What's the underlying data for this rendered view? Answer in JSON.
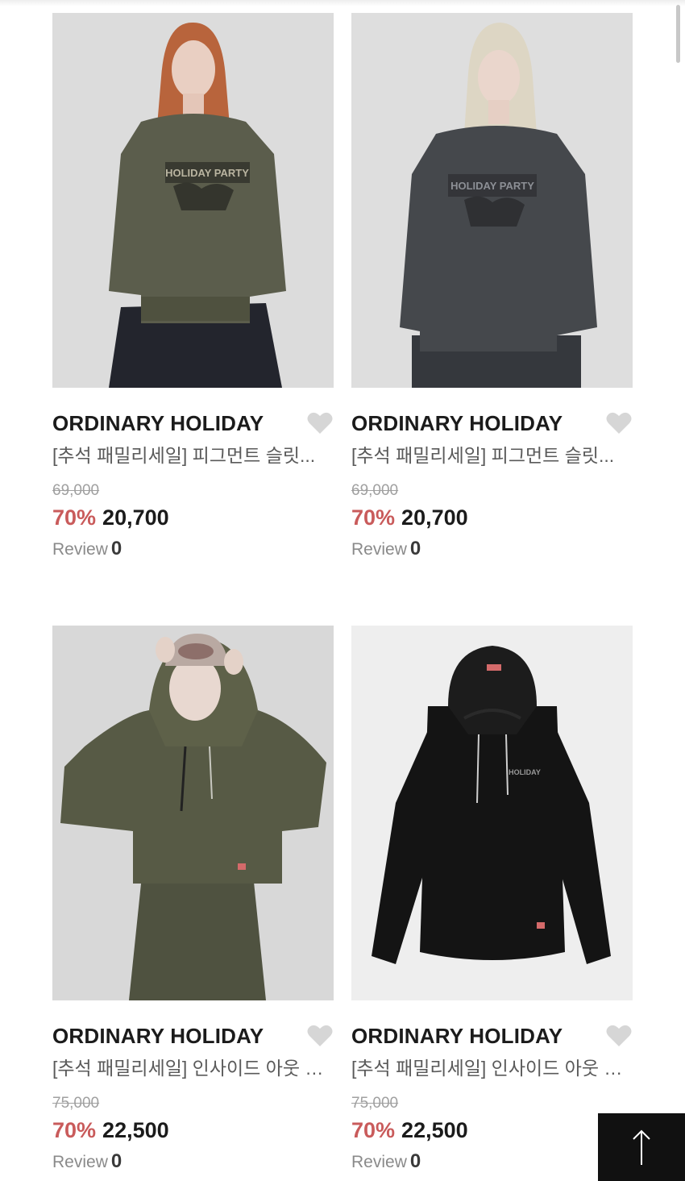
{
  "products": [
    {
      "brand": "ORDINARY HOLIDAY",
      "title": "[추석 패밀리세일] 피그먼트 슬릿...",
      "original_price": "69,000",
      "discount": "70%",
      "price": "20,700",
      "review_label": "Review",
      "review_count": "0",
      "image_print": "HOLIDAY PARTY",
      "image_color": "#5b5d4c"
    },
    {
      "brand": "ORDINARY HOLIDAY",
      "title": "[추석 패밀리세일] 피그먼트 슬릿...",
      "original_price": "69,000",
      "discount": "70%",
      "price": "20,700",
      "review_label": "Review",
      "review_count": "0",
      "image_print": "HOLIDAY PARTY",
      "image_color": "#45484c"
    },
    {
      "brand": "ORDINARY HOLIDAY",
      "title": "[추석 패밀리세일] 인사이드 아웃 후...",
      "original_price": "75,000",
      "discount": "70%",
      "price": "22,500",
      "review_label": "Review",
      "review_count": "0",
      "image_color": "#575a45"
    },
    {
      "brand": "ORDINARY HOLIDAY",
      "title": "[추석 패밀리세일] 인사이드 아웃 후...",
      "original_price": "75,000",
      "discount": "70%",
      "price": "22,500",
      "review_label": "Review",
      "review_count": "0",
      "image_print": "HOLIDAY",
      "image_color": "#141414"
    }
  ],
  "icons": {
    "wishlist": "heart-icon",
    "scroll_top": "arrow-up-icon"
  },
  "colors": {
    "discount": "#c95b5b",
    "heart": "#d6d6d6",
    "to_top_bg": "#111111"
  }
}
